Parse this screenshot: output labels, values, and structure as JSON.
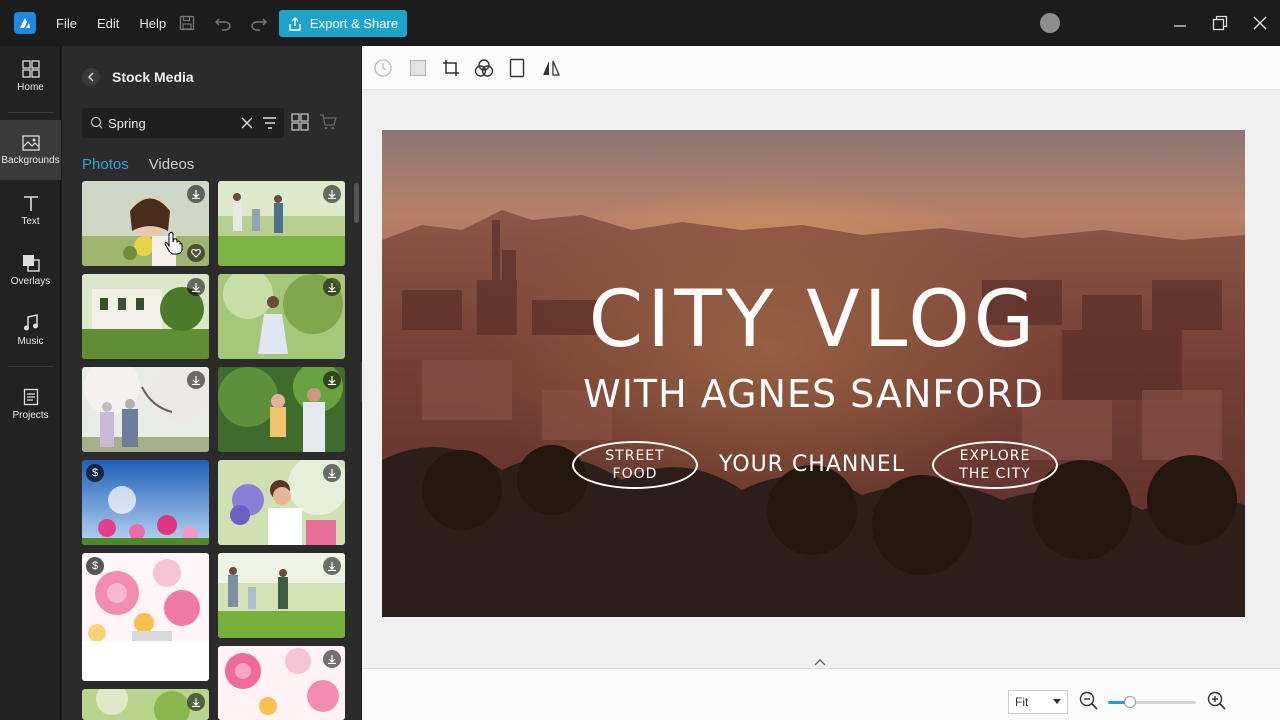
{
  "menu": {
    "file": "File",
    "edit": "Edit",
    "help": "Help"
  },
  "toolbar": {
    "export_label": "Export & Share"
  },
  "rail": {
    "items": [
      {
        "label": "Home",
        "icon": "home-icon"
      },
      {
        "label": "Backgrounds",
        "icon": "backgrounds-icon"
      },
      {
        "label": "Text",
        "icon": "text-icon"
      },
      {
        "label": "Overlays",
        "icon": "overlays-icon"
      },
      {
        "label": "Music",
        "icon": "music-icon"
      },
      {
        "label": "Projects",
        "icon": "projects-icon"
      }
    ],
    "active": "Backgrounds"
  },
  "panel": {
    "title": "Stock Media",
    "search": {
      "value": "Spring",
      "placeholder": ""
    },
    "tabs": [
      {
        "label": "Photos",
        "active": true
      },
      {
        "label": "Videos",
        "active": false
      }
    ],
    "thumbnails": [
      {
        "subject": "woman with flowers",
        "badge": "download",
        "favorite": true
      },
      {
        "subject": "family walking in park",
        "badge": "download"
      },
      {
        "subject": "white house garden",
        "badge": "download"
      },
      {
        "subject": "woman in field",
        "badge": "download"
      },
      {
        "subject": "elderly couple under blossoms",
        "badge": "download"
      },
      {
        "subject": "family with child",
        "badge": "download"
      },
      {
        "subject": "pink flowers blue sky",
        "badge": "paid"
      },
      {
        "subject": "woman smelling flowers",
        "badge": "download"
      },
      {
        "subject": "pink floral pattern",
        "badge": "paid",
        "watermark": "gettyimages"
      },
      {
        "subject": "family walking on grass",
        "badge": "download"
      },
      {
        "subject": "floral pattern",
        "badge": "download"
      },
      {
        "subject": "spring greenery",
        "badge": "download"
      },
      {
        "subject": "pink flowers",
        "badge": ""
      }
    ]
  },
  "canvas": {
    "title": "CITY VLOG",
    "subtitle": "WITH AGNES SANFORD",
    "left_pill": [
      "STREET",
      "FOOD"
    ],
    "center": "YOUR CHANNEL",
    "right_pill": [
      "EXPLORE",
      "THE CITY"
    ]
  },
  "zoom": {
    "select": "Fit",
    "level": 0.25
  },
  "colors": {
    "accent": "#1ea4c8",
    "tab_active": "#2aa7d4"
  }
}
